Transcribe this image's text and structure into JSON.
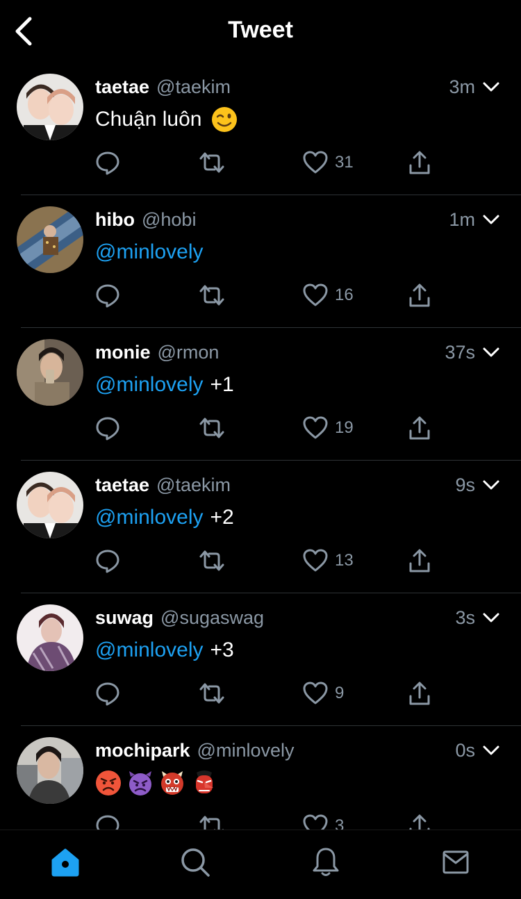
{
  "header": {
    "title": "Tweet"
  },
  "colors": {
    "accent": "#1da1f2",
    "secondary": "#8b98a5",
    "background": "#000000"
  },
  "tweets": [
    {
      "name": "taetae",
      "handle": "@taekim",
      "time": "3m",
      "text": "Chuận luôn",
      "emoji": "winking-face",
      "mention": "",
      "suffix": "",
      "likes": "31"
    },
    {
      "name": "hibo",
      "handle": "@hobi",
      "time": "1m",
      "text": "",
      "mention": "@minlovely",
      "suffix": "",
      "likes": "16"
    },
    {
      "name": "monie",
      "handle": "@rmon",
      "time": "37s",
      "text": "",
      "mention": "@minlovely",
      "suffix": "+1",
      "likes": "19"
    },
    {
      "name": "taetae",
      "handle": "@taekim",
      "time": "9s",
      "text": "",
      "mention": "@minlovely",
      "suffix": "+2",
      "likes": "13"
    },
    {
      "name": "suwag",
      "handle": "@sugaswag",
      "time": "3s",
      "text": "",
      "mention": "@minlovely",
      "suffix": "+3",
      "likes": "9"
    },
    {
      "name": "mochipark",
      "handle": "@minlovely",
      "time": "0s",
      "text": "",
      "emojis": [
        "pouting-face",
        "angry-face-with-horns",
        "ogre",
        "goblin"
      ],
      "likes": "3"
    }
  ],
  "tabbar": {
    "active": "home",
    "items": [
      "home-icon",
      "search-icon",
      "bell-icon",
      "mail-icon"
    ]
  }
}
